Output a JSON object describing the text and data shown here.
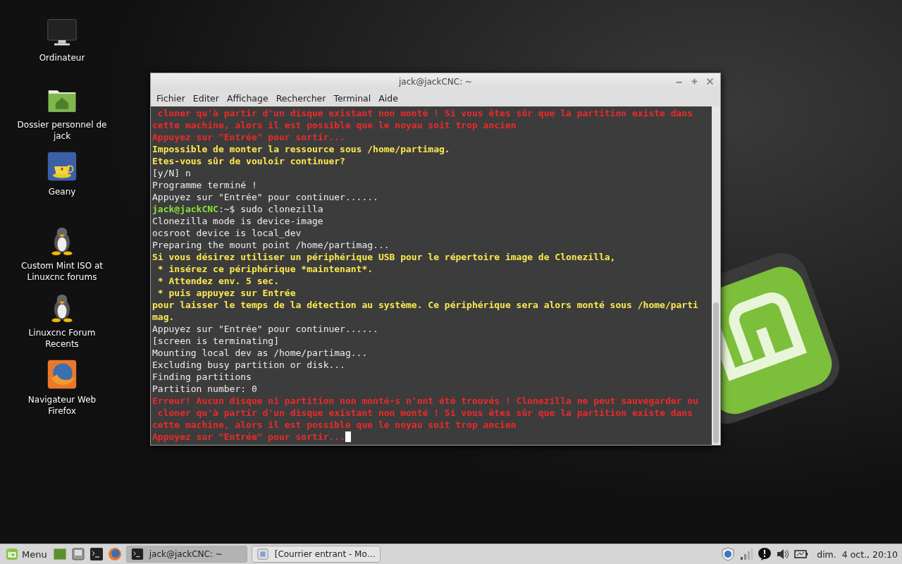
{
  "desktop_icons": [
    {
      "kind": "monitor",
      "label": "Ordinateur"
    },
    {
      "kind": "home-folder",
      "label": "Dossier personnel de jack"
    },
    {
      "kind": "teapot",
      "label": "Geany"
    },
    {
      "kind": "penguin",
      "label": "Custom Mint ISO at Linuxcnc forums"
    },
    {
      "kind": "penguin",
      "label": "Linuxcnc Forum Recents"
    },
    {
      "kind": "globe",
      "label": "Navigateur Web Firefox"
    }
  ],
  "window": {
    "title": "jack@jackCNC: ~",
    "menu": [
      "Fichier",
      "Editer",
      "Affichage",
      "Rechercher",
      "Terminal",
      "Aide"
    ],
    "terminal": {
      "cursor": true,
      "lines": [
        {
          "kind": "error",
          "text": " cloner qu'à partir d'un disque existant non monté ! Si vous êtes sûr que la partition existe dans"
        },
        {
          "kind": "error",
          "text": "cette machine, alors il est possible que le noyau soit trop ancien"
        },
        {
          "kind": "error",
          "text": "Appuyez sur \"Entrée\" pour sortir..."
        },
        {
          "kind": "warning",
          "text": "Impossible de monter la ressource sous /home/partimag."
        },
        {
          "kind": "warning",
          "text": "Etes-vous sûr de vouloir continuer?"
        },
        {
          "kind": "normal",
          "text": "[y/N] n"
        },
        {
          "kind": "normal",
          "text": "Programme terminé !"
        },
        {
          "kind": "normal",
          "text": "Appuyez sur \"Entrée\" pour continuer......"
        },
        {
          "kind": "prompt",
          "user": "jack@jackCNC",
          "text": ":~$ sudo clonezilla"
        },
        {
          "kind": "normal",
          "text": "Clonezilla mode is device-image"
        },
        {
          "kind": "normal",
          "text": "ocsroot device is local_dev"
        },
        {
          "kind": "normal",
          "text": "Preparing the mount point /home/partimag..."
        },
        {
          "kind": "warning",
          "text": "Si vous désirez utiliser un périphérique USB pour le répertoire image de Clonezilla,"
        },
        {
          "kind": "warning",
          "text": " * insérez ce périphérique *maintenant*."
        },
        {
          "kind": "warning",
          "text": " * Attendez env. 5 sec."
        },
        {
          "kind": "warning",
          "text": " * puis appuyez sur Entrée"
        },
        {
          "kind": "warning",
          "text": "pour laisser le temps de la détection au système. Ce périphérique sera alors monté sous /home/parti"
        },
        {
          "kind": "warning",
          "text": "mag."
        },
        {
          "kind": "normal",
          "text": "Appuyez sur \"Entrée\" pour continuer......"
        },
        {
          "kind": "normal",
          "text": "[screen is terminating]"
        },
        {
          "kind": "normal",
          "text": "Mounting local dev as /home/partimag..."
        },
        {
          "kind": "normal",
          "text": "Excluding busy partition or disk..."
        },
        {
          "kind": "normal",
          "text": "Finding partitions"
        },
        {
          "kind": "normal",
          "text": "Partition number: 0"
        },
        {
          "kind": "error",
          "text": "Erreur! Aucun disque ni partition non monté-s n'ont été trouvés ! Clonezilla ne peut sauvegarder ou"
        },
        {
          "kind": "error",
          "text": " cloner qu'à partir d'un disque existant non monté ! Si vous êtes sûr que la partition existe dans"
        },
        {
          "kind": "error",
          "text": "cette machine, alors il est possible que le noyau soit trop ancien"
        },
        {
          "kind": "error",
          "text": "Appuyez sur \"Entrée\" pour sortir..."
        }
      ]
    }
  },
  "taskbar": {
    "menu_label": "Menu",
    "launchers": [
      {
        "kind": "desktop"
      },
      {
        "kind": "files"
      },
      {
        "kind": "terminal"
      },
      {
        "kind": "browser"
      }
    ],
    "windows": [
      {
        "kind": "terminal",
        "label": "jack@jackCNC: ~",
        "selected": true
      },
      {
        "kind": "mail",
        "label": "[Courrier entrant - Mo…",
        "selected": false
      }
    ],
    "tray": [
      {
        "kind": "shield"
      },
      {
        "kind": "signal"
      },
      {
        "kind": "notification"
      },
      {
        "kind": "volume"
      },
      {
        "kind": "battery"
      }
    ],
    "clock": "dim.  4 oct., 20:10"
  }
}
